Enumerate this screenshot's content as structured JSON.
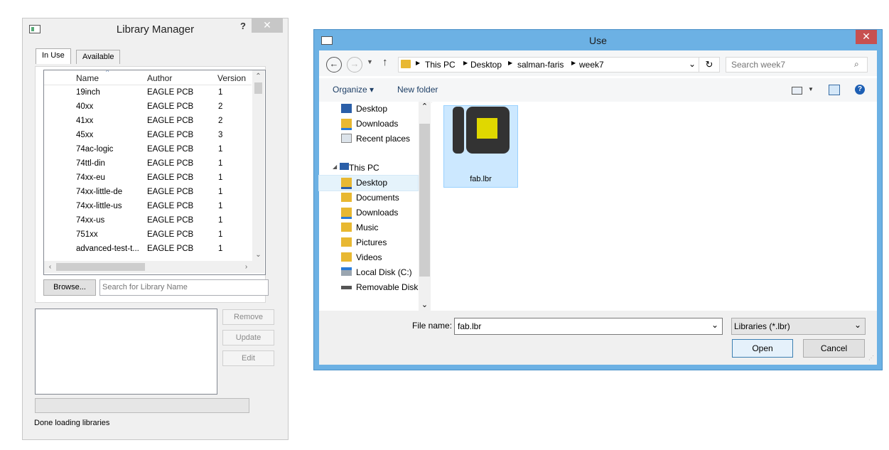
{
  "library_manager": {
    "title": "Library Manager",
    "help_label": "?",
    "close_label": "✕",
    "tabs": [
      {
        "label": "In Use"
      },
      {
        "label": "Available"
      }
    ],
    "columns": {
      "name": "Name",
      "author": "Author",
      "version": "Version"
    },
    "rows": [
      {
        "name": "19inch",
        "author": "EAGLE PCB",
        "version": "1"
      },
      {
        "name": "40xx",
        "author": "EAGLE PCB",
        "version": "2"
      },
      {
        "name": "41xx",
        "author": "EAGLE PCB",
        "version": "2"
      },
      {
        "name": "45xx",
        "author": "EAGLE PCB",
        "version": "3"
      },
      {
        "name": "74ac-logic",
        "author": "EAGLE PCB",
        "version": "1"
      },
      {
        "name": "74ttl-din",
        "author": "EAGLE PCB",
        "version": "1"
      },
      {
        "name": "74xx-eu",
        "author": "EAGLE PCB",
        "version": "1"
      },
      {
        "name": "74xx-little-de",
        "author": "EAGLE PCB",
        "version": "1"
      },
      {
        "name": "74xx-little-us",
        "author": "EAGLE PCB",
        "version": "1"
      },
      {
        "name": "74xx-us",
        "author": "EAGLE PCB",
        "version": "1"
      },
      {
        "name": "751xx",
        "author": "EAGLE PCB",
        "version": "1"
      },
      {
        "name": "advanced-test-t...",
        "author": "EAGLE PCB",
        "version": "1"
      }
    ],
    "browse_label": "Browse...",
    "search_placeholder": "Search for Library Name",
    "remove_label": "Remove",
    "update_label": "Update",
    "edit_label": "Edit",
    "status": "Done loading libraries"
  },
  "use_dialog": {
    "title": "Use",
    "close_label": "✕",
    "breadcrumb": [
      "This PC",
      "Desktop",
      "salman-faris",
      "week7"
    ],
    "search_placeholder": "Search week7",
    "organize_label": "Organize ▾",
    "new_folder_label": "New folder",
    "nav_items": [
      {
        "label": "Desktop",
        "icon": "desktop-icon"
      },
      {
        "label": "Downloads",
        "icon": "downloads-icon"
      },
      {
        "label": "Recent places",
        "icon": "recent-places-icon"
      },
      {
        "label": "This PC",
        "icon": "this-pc-icon"
      },
      {
        "label": "Desktop",
        "icon": "desktop-icon"
      },
      {
        "label": "Documents",
        "icon": "documents-icon"
      },
      {
        "label": "Downloads",
        "icon": "downloads-icon"
      },
      {
        "label": "Music",
        "icon": "music-icon"
      },
      {
        "label": "Pictures",
        "icon": "pictures-icon"
      },
      {
        "label": "Videos",
        "icon": "videos-icon"
      },
      {
        "label": "Local Disk (C:)",
        "icon": "local-disk-icon"
      },
      {
        "label": "Removable Disk (",
        "icon": "removable-disk-icon"
      }
    ],
    "file": {
      "name": "fab.lbr",
      "icon": "library-file-icon",
      "accent": "#e0d800"
    },
    "file_name_label": "File name:",
    "file_name_value": "fab.lbr",
    "file_type": "Libraries (*.lbr)",
    "open_label": "Open",
    "cancel_label": "Cancel"
  }
}
